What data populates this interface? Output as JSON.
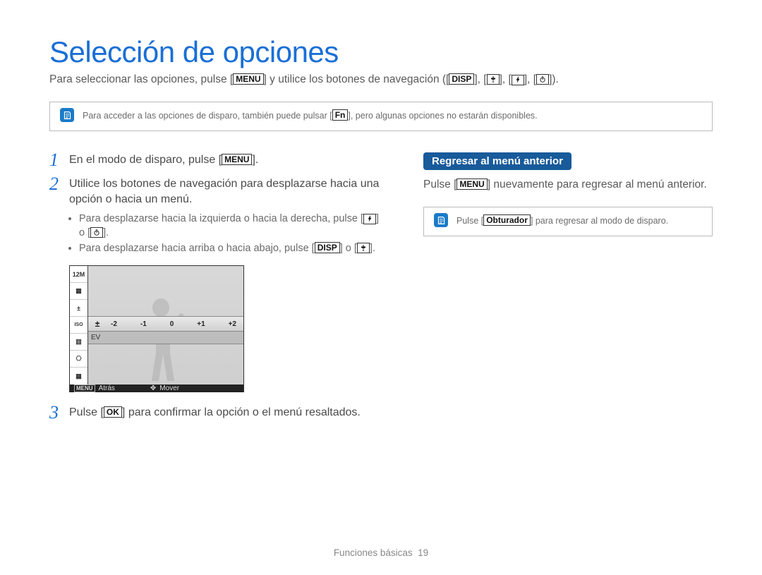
{
  "title": "Selección de opciones",
  "intro": {
    "pre": "Para seleccionar las opciones, pulse [",
    "menu": "MENU",
    "mid": "] y utilice los botones de navegación ([",
    "disp": "DISP",
    "sep": "], [",
    "end": "])."
  },
  "nav_icons": {
    "a": "macro",
    "b": "flash",
    "c": "timer"
  },
  "note1": {
    "pre": "Para acceder a las opciones de disparo, también puede pulsar [",
    "fn": "Fn",
    "post": "], pero algunas opciones no estarán disponibles."
  },
  "steps": {
    "s1_num": "1",
    "s1_pre": "En el modo de disparo, pulse [",
    "s1_btn": "MENU",
    "s1_post": "].",
    "s2_num": "2",
    "s2_text": "Utilice los botones de navegación para desplazarse hacia una opción o hacia un menú.",
    "s2_b1_pre": "Para desplazarse hacia la izquierda o hacia la derecha, pulse [",
    "s2_b1_mid": "] o [",
    "s2_b1_post": "].",
    "s2_b2_pre": "Para desplazarse hacia arriba o hacia abajo, pulse [",
    "s2_b2_disp": "DISP",
    "s2_b2_mid": "] o [",
    "s2_b2_post": "].",
    "s3_num": "3",
    "s3_pre": "Pulse [",
    "s3_btn": "OK",
    "s3_post": "] para confirmar la opción o el menú resaltados."
  },
  "screenshot": {
    "side_icons": [
      "12M",
      "▦",
      "±",
      "ISO",
      "▥",
      "⎔",
      "▦"
    ],
    "ev_ticks": [
      "-2",
      "-1",
      "0",
      "+1",
      "+2"
    ],
    "ev_label": "EV",
    "bottom_left_icon": "MENU",
    "bottom_left": "Atrás",
    "bottom_right_icon": "✥",
    "bottom_right": "Mover"
  },
  "right": {
    "pill": "Regresar al menú anterior",
    "text_pre": "Pulse [",
    "text_btn": "MENU",
    "text_post": "] nuevamente para regresar al menú anterior.",
    "note_pre": "Pulse [",
    "note_btn": "Obturador",
    "note_post": "] para regresar al modo de disparo."
  },
  "footer": {
    "section": "Funciones básicas",
    "page": "19"
  }
}
